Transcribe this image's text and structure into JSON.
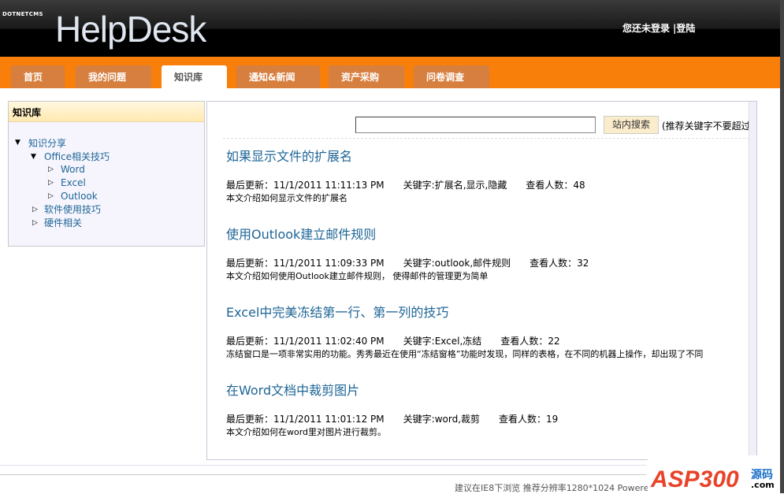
{
  "header": {
    "brand_small": "DOTNETCMS",
    "brand": "HelpDesk",
    "login_status": "您还未登录",
    "login_link": "|登陆"
  },
  "nav": {
    "tabs": [
      {
        "label": "首页"
      },
      {
        "label": "我的问题"
      },
      {
        "label": "知识库",
        "active": true
      },
      {
        "label": "通知&新闻"
      },
      {
        "label": "资产采购"
      },
      {
        "label": "问卷调查"
      }
    ]
  },
  "sidebar": {
    "title": "知识库",
    "tree": [
      {
        "label": "知识分享"
      },
      {
        "label": "Office相关技巧"
      },
      {
        "label": "Word"
      },
      {
        "label": "Excel"
      },
      {
        "label": "Outlook"
      },
      {
        "label": "软件使用技巧"
      },
      {
        "label": "硬件相关"
      }
    ]
  },
  "search": {
    "value": "",
    "button": "站内搜索",
    "hint": "(推荐关键字不要超过"
  },
  "articles": [
    {
      "title": "如果显示文件的扩展名",
      "updated": "最后更新：11/1/2011 11:11:13 PM",
      "keywords": "关键字:扩展名,显示,隐藏",
      "views": "查看人数：48",
      "desc": "本文介绍如何显示文件的扩展名"
    },
    {
      "title": "使用Outlook建立邮件规则",
      "updated": "最后更新：11/1/2011 11:09:33 PM",
      "keywords": "关键字:outlook,邮件规则",
      "views": "查看人数：32",
      "desc": "本文介绍如何使用Outlook建立邮件规则， 使得邮件的管理更为简单"
    },
    {
      "title": "Excel中完美冻结第一行、第一列的技巧",
      "updated": "最后更新：11/1/2011 11:02:40 PM",
      "keywords": "关键字:Excel,冻结",
      "views": "查看人数：22",
      "desc": "冻结窗口是一项非常实用的功能。秀秀最近在使用“冻结窗格”功能时发现，同样的表格，在不同的机器上操作，却出现了不同"
    },
    {
      "title": "在Word文档中裁剪图片",
      "updated": "最后更新：11/1/2011 11:01:12 PM",
      "keywords": "关键字:word,裁剪",
      "views": "查看人数：19",
      "desc": "本文介绍如何在word里对图片进行裁剪。"
    }
  ],
  "footer": {
    "text": "建议在IE8下浏览  推荐分辨率1280*1024 Powered by"
  },
  "watermark": {
    "text": "ASP300",
    "sub": "源码",
    "domain": ".com"
  }
}
